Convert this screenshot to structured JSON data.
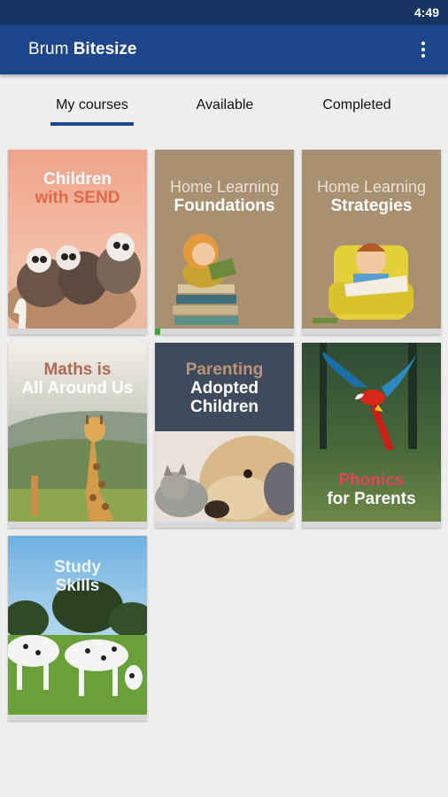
{
  "status_bar": {
    "time": "4:49"
  },
  "app_bar": {
    "title_light": "Brum",
    "title_bold": "Bitesize",
    "menu_icon": "more-vert-icon"
  },
  "tabs": [
    {
      "label": "My courses",
      "selected": true
    },
    {
      "label": "Available",
      "selected": false
    },
    {
      "label": "Completed",
      "selected": false
    }
  ],
  "colors": {
    "status_bar": "#163464",
    "app_bar": "#1d4589",
    "background": "#eeeeee",
    "progress": "#2eab38"
  },
  "courses": [
    {
      "line1": "Children",
      "line2": "with SEND",
      "progress": 0
    },
    {
      "line1": "Home Learning",
      "line2": "Foundations",
      "progress": 0.04
    },
    {
      "line1": "Home Learning",
      "line2": "Strategies",
      "progress": 0
    },
    {
      "line1": "Maths is",
      "line2": "All Around Us",
      "progress": 0
    },
    {
      "line1": "Parenting",
      "line2": "Adopted",
      "line3": "Children",
      "progress": 0
    },
    {
      "line1": "Phonics",
      "line2": "for Parents",
      "progress": 0
    },
    {
      "line1": "Study",
      "line2": "Skills",
      "progress": 0
    }
  ]
}
